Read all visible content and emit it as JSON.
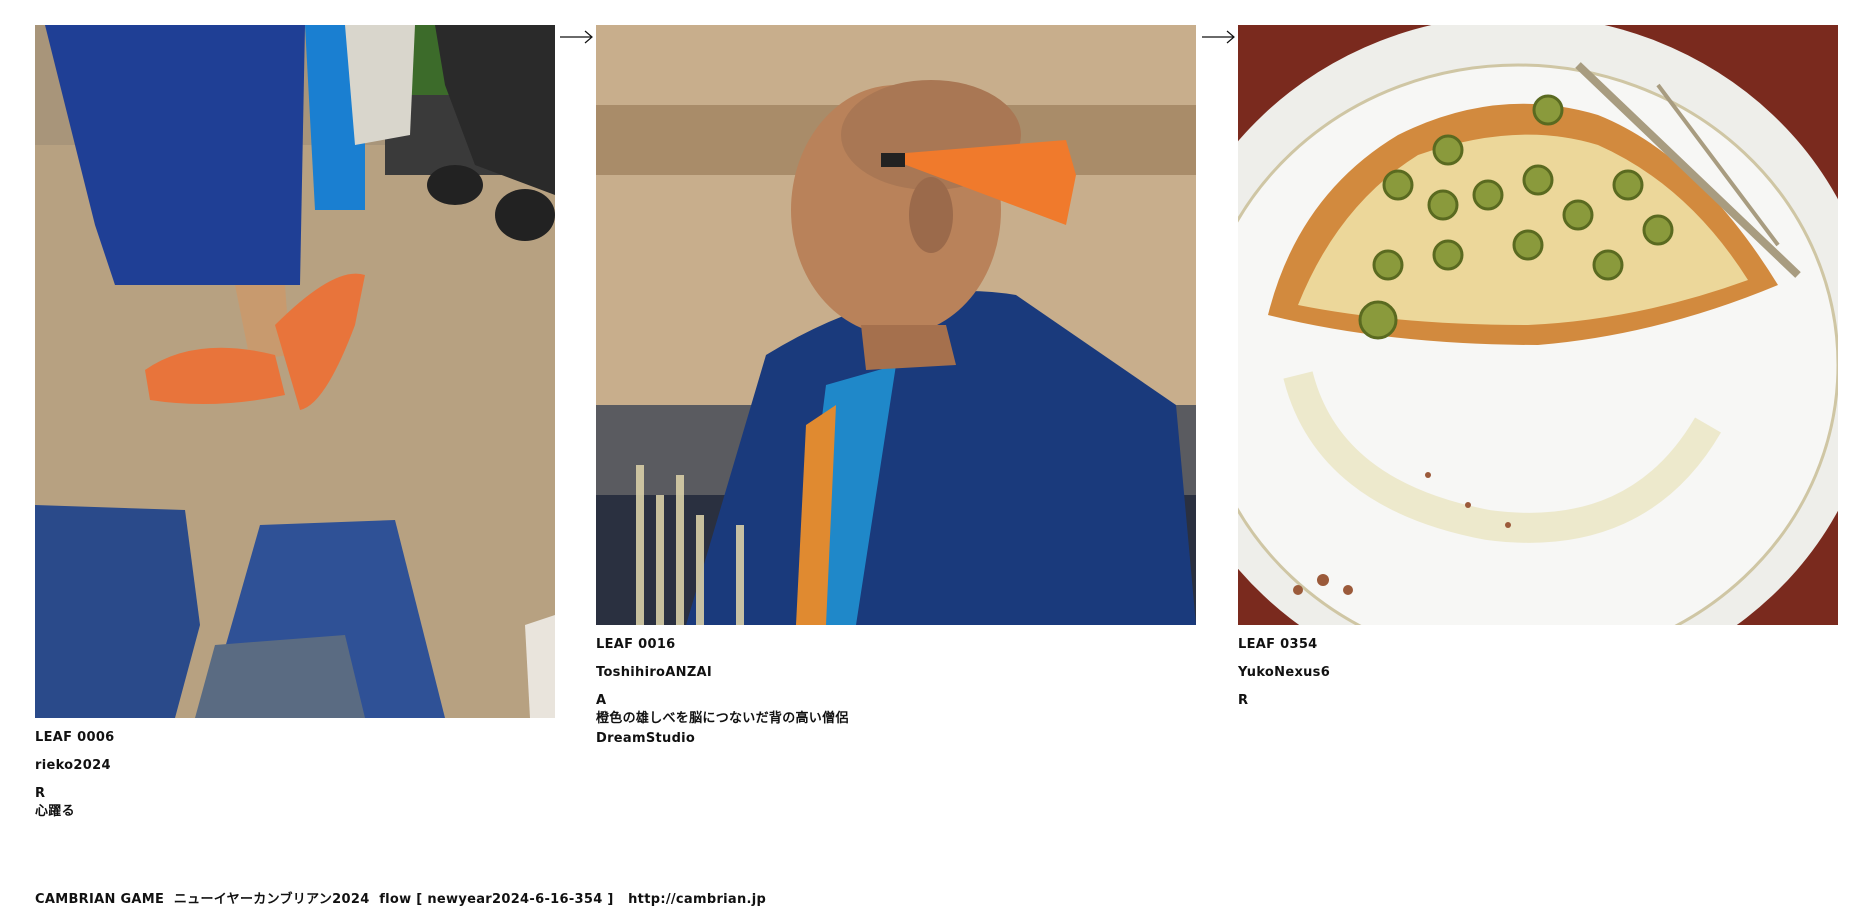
{
  "cards": [
    {
      "leaf": "LEAF 0006",
      "author": "rieko2024",
      "tag": "R",
      "lines": [
        "心躍る"
      ]
    },
    {
      "leaf": "LEAF 0016",
      "author": "ToshihiroANZAI",
      "tag": "A",
      "lines": [
        "橙色の雄しべを脳につないだ背の高い僧侶",
        "DreamStudio"
      ]
    },
    {
      "leaf": "LEAF 0354",
      "author": "YukoNexus6",
      "tag": "R",
      "lines": []
    }
  ],
  "footer": {
    "brand": "CAMBRIAN GAME",
    "event": "ニューイヤーカンブリアン2024",
    "flow": "flow [ newyear2024-6-16-354 ]",
    "url": "http://cambrian.jp"
  },
  "colors": {
    "text": "#111111",
    "background": "#ffffff"
  }
}
